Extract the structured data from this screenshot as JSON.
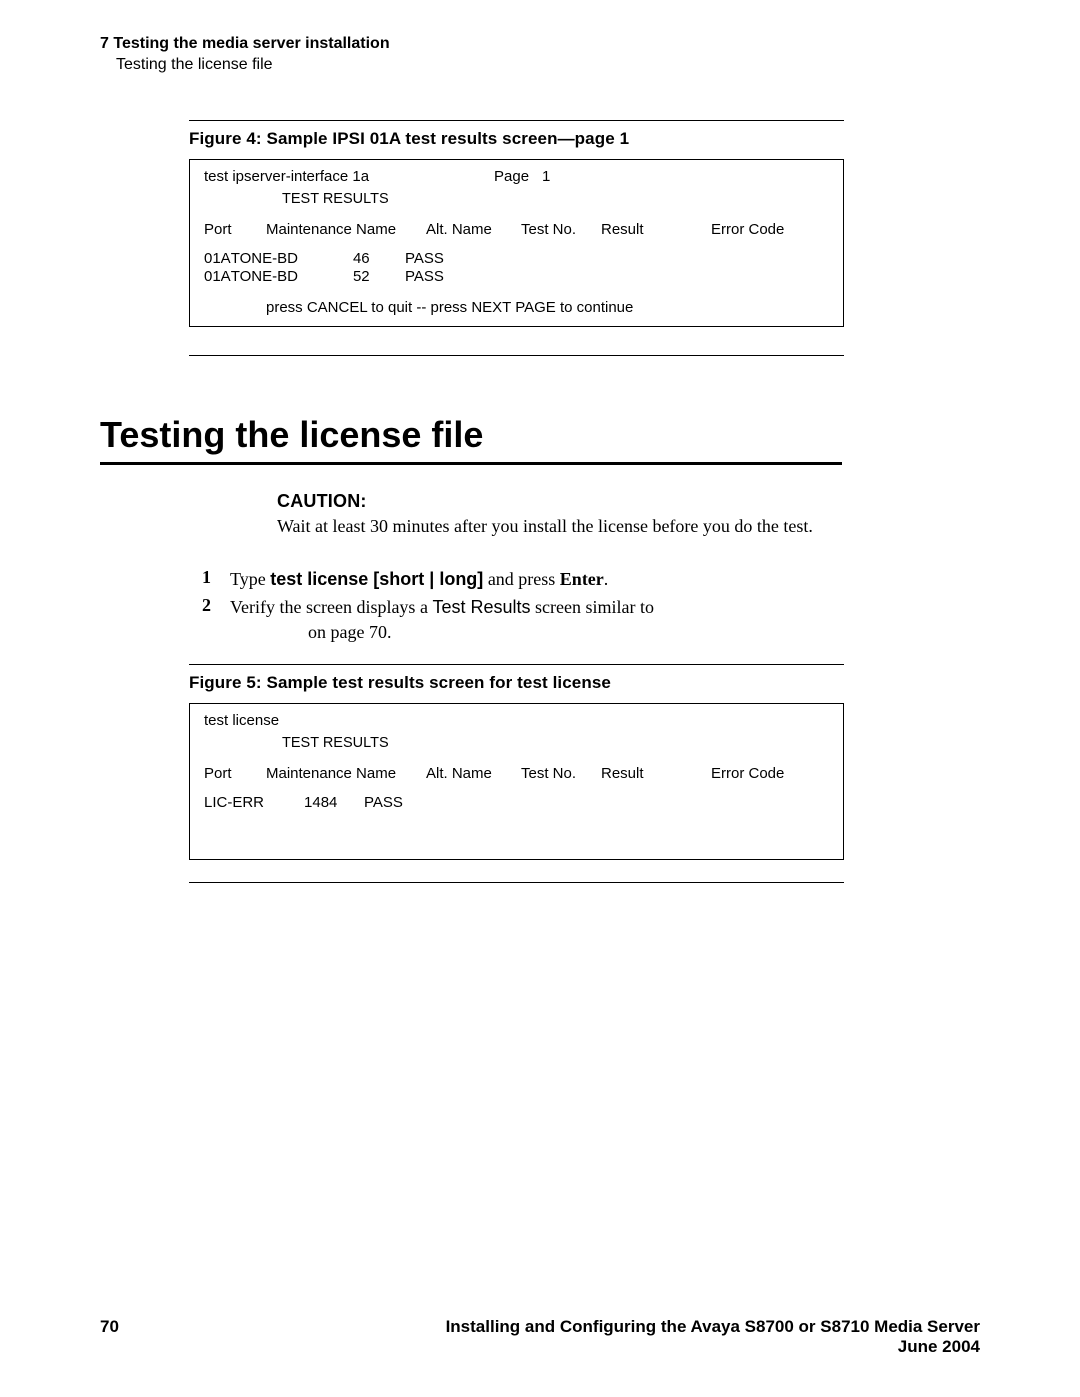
{
  "header": {
    "chapter_num": "7",
    "chapter_title": "Testing the media server installation",
    "section": "Testing the license file"
  },
  "figure4": {
    "caption": "Figure 4: Sample IPSI 01A test results screen—page 1",
    "cmd": "test ipserver-interface 1a",
    "page_label": "Page",
    "page_num": "1",
    "heading": "TEST RESULTS",
    "cols": {
      "port": "Port",
      "maint": "Maintenance Name",
      "alt": "Alt. Name",
      "testno": "Test No.",
      "result": "Result",
      "error": "Error Code"
    },
    "rows": [
      {
        "port": "01A",
        "maint": "TONE-BD",
        "testno": "46",
        "result": "PASS"
      },
      {
        "port": "01A",
        "maint": "TONE-BD",
        "testno": "52",
        "result": "PASS"
      }
    ],
    "footer": "press CANCEL to quit --  press NEXT PAGE to continue"
  },
  "section_heading": "Testing the license file",
  "caution": {
    "label": "CAUTION:",
    "text": "Wait at least 30 minutes after you install the license before you do the test."
  },
  "steps": [
    {
      "num": "1",
      "pre": "Type ",
      "cmd": "test license [short | long]",
      "mid": " and press ",
      "key": "Enter",
      "post": "."
    },
    {
      "num": "2",
      "line1a": "Verify the screen displays a ",
      "line1b_sans": "Test Results",
      "line1c": " screen similar to",
      "line2": "on page 70."
    }
  ],
  "figure5": {
    "caption": "Figure 5: Sample test results screen for test license",
    "cmd": "test license",
    "heading": "TEST RESULTS",
    "cols": {
      "port": "Port",
      "maint": "Maintenance Name",
      "alt": "Alt. Name",
      "testno": "Test No.",
      "result": "Result",
      "error": "Error Code"
    },
    "rows": [
      {
        "port": "",
        "maint": "LIC-ERR",
        "testno": "1484",
        "result": "PASS"
      }
    ]
  },
  "footer": {
    "page": "70",
    "title": "Installing and Configuring the Avaya S8700 or S8710 Media Server",
    "date": "June 2004"
  }
}
